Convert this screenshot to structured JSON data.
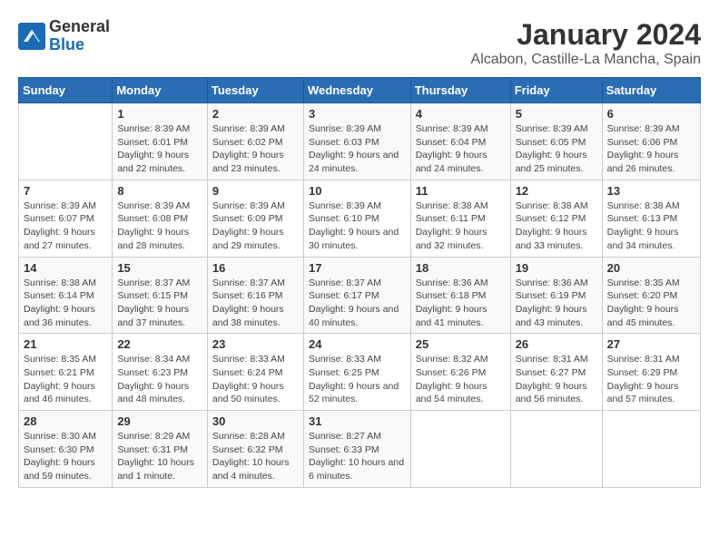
{
  "header": {
    "logo_line1": "General",
    "logo_line2": "Blue",
    "title": "January 2024",
    "subtitle": "Alcabon, Castille-La Mancha, Spain"
  },
  "weekdays": [
    "Sunday",
    "Monday",
    "Tuesday",
    "Wednesday",
    "Thursday",
    "Friday",
    "Saturday"
  ],
  "weeks": [
    [
      {
        "day": "",
        "sunrise": "",
        "sunset": "",
        "daylight": ""
      },
      {
        "day": "1",
        "sunrise": "Sunrise: 8:39 AM",
        "sunset": "Sunset: 6:01 PM",
        "daylight": "Daylight: 9 hours and 22 minutes."
      },
      {
        "day": "2",
        "sunrise": "Sunrise: 8:39 AM",
        "sunset": "Sunset: 6:02 PM",
        "daylight": "Daylight: 9 hours and 23 minutes."
      },
      {
        "day": "3",
        "sunrise": "Sunrise: 8:39 AM",
        "sunset": "Sunset: 6:03 PM",
        "daylight": "Daylight: 9 hours and 24 minutes."
      },
      {
        "day": "4",
        "sunrise": "Sunrise: 8:39 AM",
        "sunset": "Sunset: 6:04 PM",
        "daylight": "Daylight: 9 hours and 24 minutes."
      },
      {
        "day": "5",
        "sunrise": "Sunrise: 8:39 AM",
        "sunset": "Sunset: 6:05 PM",
        "daylight": "Daylight: 9 hours and 25 minutes."
      },
      {
        "day": "6",
        "sunrise": "Sunrise: 8:39 AM",
        "sunset": "Sunset: 6:06 PM",
        "daylight": "Daylight: 9 hours and 26 minutes."
      }
    ],
    [
      {
        "day": "7",
        "sunrise": "Sunrise: 8:39 AM",
        "sunset": "Sunset: 6:07 PM",
        "daylight": "Daylight: 9 hours and 27 minutes."
      },
      {
        "day": "8",
        "sunrise": "Sunrise: 8:39 AM",
        "sunset": "Sunset: 6:08 PM",
        "daylight": "Daylight: 9 hours and 28 minutes."
      },
      {
        "day": "9",
        "sunrise": "Sunrise: 8:39 AM",
        "sunset": "Sunset: 6:09 PM",
        "daylight": "Daylight: 9 hours and 29 minutes."
      },
      {
        "day": "10",
        "sunrise": "Sunrise: 8:39 AM",
        "sunset": "Sunset: 6:10 PM",
        "daylight": "Daylight: 9 hours and 30 minutes."
      },
      {
        "day": "11",
        "sunrise": "Sunrise: 8:38 AM",
        "sunset": "Sunset: 6:11 PM",
        "daylight": "Daylight: 9 hours and 32 minutes."
      },
      {
        "day": "12",
        "sunrise": "Sunrise: 8:38 AM",
        "sunset": "Sunset: 6:12 PM",
        "daylight": "Daylight: 9 hours and 33 minutes."
      },
      {
        "day": "13",
        "sunrise": "Sunrise: 8:38 AM",
        "sunset": "Sunset: 6:13 PM",
        "daylight": "Daylight: 9 hours and 34 minutes."
      }
    ],
    [
      {
        "day": "14",
        "sunrise": "Sunrise: 8:38 AM",
        "sunset": "Sunset: 6:14 PM",
        "daylight": "Daylight: 9 hours and 36 minutes."
      },
      {
        "day": "15",
        "sunrise": "Sunrise: 8:37 AM",
        "sunset": "Sunset: 6:15 PM",
        "daylight": "Daylight: 9 hours and 37 minutes."
      },
      {
        "day": "16",
        "sunrise": "Sunrise: 8:37 AM",
        "sunset": "Sunset: 6:16 PM",
        "daylight": "Daylight: 9 hours and 38 minutes."
      },
      {
        "day": "17",
        "sunrise": "Sunrise: 8:37 AM",
        "sunset": "Sunset: 6:17 PM",
        "daylight": "Daylight: 9 hours and 40 minutes."
      },
      {
        "day": "18",
        "sunrise": "Sunrise: 8:36 AM",
        "sunset": "Sunset: 6:18 PM",
        "daylight": "Daylight: 9 hours and 41 minutes."
      },
      {
        "day": "19",
        "sunrise": "Sunrise: 8:36 AM",
        "sunset": "Sunset: 6:19 PM",
        "daylight": "Daylight: 9 hours and 43 minutes."
      },
      {
        "day": "20",
        "sunrise": "Sunrise: 8:35 AM",
        "sunset": "Sunset: 6:20 PM",
        "daylight": "Daylight: 9 hours and 45 minutes."
      }
    ],
    [
      {
        "day": "21",
        "sunrise": "Sunrise: 8:35 AM",
        "sunset": "Sunset: 6:21 PM",
        "daylight": "Daylight: 9 hours and 46 minutes."
      },
      {
        "day": "22",
        "sunrise": "Sunrise: 8:34 AM",
        "sunset": "Sunset: 6:23 PM",
        "daylight": "Daylight: 9 hours and 48 minutes."
      },
      {
        "day": "23",
        "sunrise": "Sunrise: 8:33 AM",
        "sunset": "Sunset: 6:24 PM",
        "daylight": "Daylight: 9 hours and 50 minutes."
      },
      {
        "day": "24",
        "sunrise": "Sunrise: 8:33 AM",
        "sunset": "Sunset: 6:25 PM",
        "daylight": "Daylight: 9 hours and 52 minutes."
      },
      {
        "day": "25",
        "sunrise": "Sunrise: 8:32 AM",
        "sunset": "Sunset: 6:26 PM",
        "daylight": "Daylight: 9 hours and 54 minutes."
      },
      {
        "day": "26",
        "sunrise": "Sunrise: 8:31 AM",
        "sunset": "Sunset: 6:27 PM",
        "daylight": "Daylight: 9 hours and 56 minutes."
      },
      {
        "day": "27",
        "sunrise": "Sunrise: 8:31 AM",
        "sunset": "Sunset: 6:29 PM",
        "daylight": "Daylight: 9 hours and 57 minutes."
      }
    ],
    [
      {
        "day": "28",
        "sunrise": "Sunrise: 8:30 AM",
        "sunset": "Sunset: 6:30 PM",
        "daylight": "Daylight: 9 hours and 59 minutes."
      },
      {
        "day": "29",
        "sunrise": "Sunrise: 8:29 AM",
        "sunset": "Sunset: 6:31 PM",
        "daylight": "Daylight: 10 hours and 1 minute."
      },
      {
        "day": "30",
        "sunrise": "Sunrise: 8:28 AM",
        "sunset": "Sunset: 6:32 PM",
        "daylight": "Daylight: 10 hours and 4 minutes."
      },
      {
        "day": "31",
        "sunrise": "Sunrise: 8:27 AM",
        "sunset": "Sunset: 6:33 PM",
        "daylight": "Daylight: 10 hours and 6 minutes."
      },
      {
        "day": "",
        "sunrise": "",
        "sunset": "",
        "daylight": ""
      },
      {
        "day": "",
        "sunrise": "",
        "sunset": "",
        "daylight": ""
      },
      {
        "day": "",
        "sunrise": "",
        "sunset": "",
        "daylight": ""
      }
    ]
  ]
}
